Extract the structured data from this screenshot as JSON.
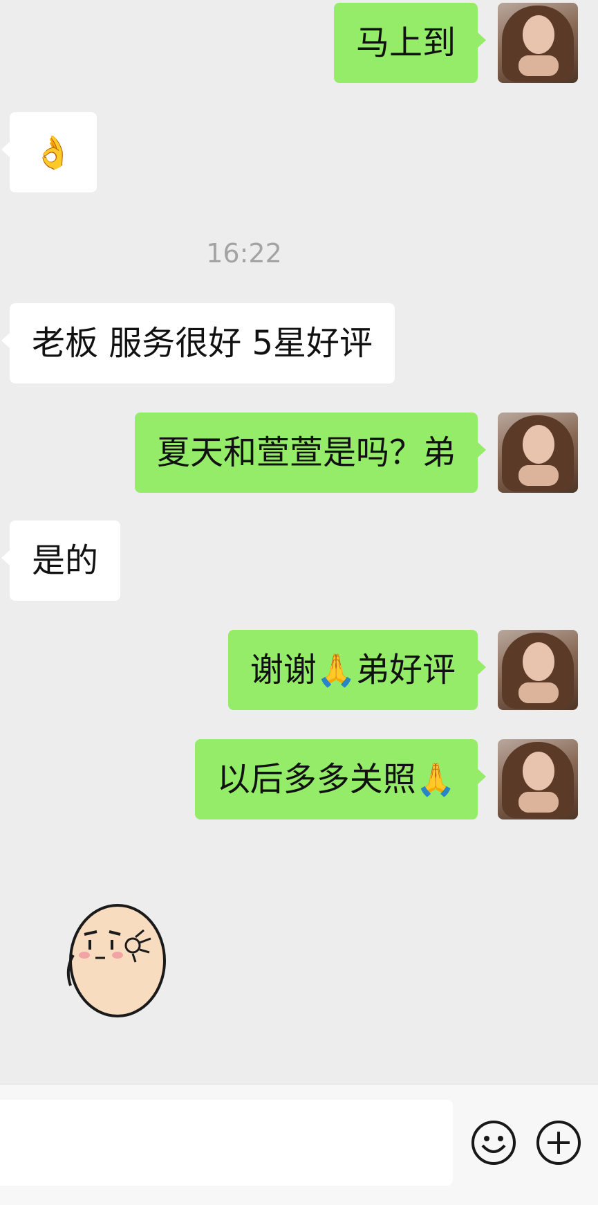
{
  "timestamp": "16:22",
  "messages": [
    {
      "side": "out",
      "text": "马上到"
    },
    {
      "side": "in",
      "emoji": "👌"
    },
    {
      "side": "in",
      "text": "老板 服务很好 5星好评"
    },
    {
      "side": "out",
      "text": "夏天和萱萱是吗？弟"
    },
    {
      "side": "in",
      "text": "是的"
    },
    {
      "side": "out",
      "text_before": "谢谢",
      "emoji": "🙏",
      "text_after": "弟好评"
    },
    {
      "side": "out",
      "text_before": "以后多多关照",
      "emoji": "🙏"
    }
  ],
  "sticker": {
    "icon": "ok-hand-egg-sticker"
  },
  "input_bar": {
    "input_value": "",
    "emoji_button_icon": "smiley-icon",
    "more_button_icon": "plus-circle-icon"
  },
  "colors": {
    "background": "#ededed",
    "outgoing_bubble": "#95ec69",
    "incoming_bubble": "#ffffff",
    "timestamp_text": "#a3a3a3"
  }
}
